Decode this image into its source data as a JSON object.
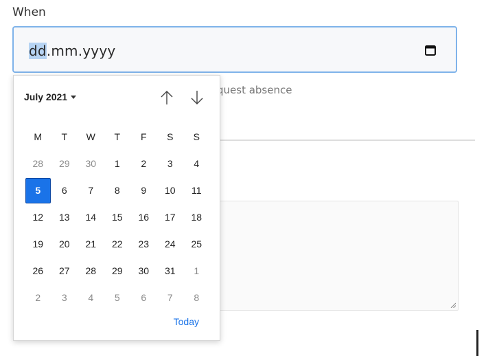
{
  "field": {
    "label": "When",
    "date_placeholder_day": "dd",
    "date_placeholder_rest": ".mm.yyyy",
    "helper_text": "quest absence"
  },
  "calendar": {
    "month_label": "July 2021",
    "weekdays": [
      "M",
      "T",
      "W",
      "T",
      "F",
      "S",
      "S"
    ],
    "weeks": [
      [
        {
          "d": "28",
          "o": true
        },
        {
          "d": "29",
          "o": true
        },
        {
          "d": "30",
          "o": true
        },
        {
          "d": "1"
        },
        {
          "d": "2"
        },
        {
          "d": "3"
        },
        {
          "d": "4"
        }
      ],
      [
        {
          "d": "5",
          "sel": true
        },
        {
          "d": "6"
        },
        {
          "d": "7"
        },
        {
          "d": "8"
        },
        {
          "d": "9"
        },
        {
          "d": "10"
        },
        {
          "d": "11"
        }
      ],
      [
        {
          "d": "12"
        },
        {
          "d": "13"
        },
        {
          "d": "14"
        },
        {
          "d": "15"
        },
        {
          "d": "16"
        },
        {
          "d": "17"
        },
        {
          "d": "18"
        }
      ],
      [
        {
          "d": "19"
        },
        {
          "d": "20"
        },
        {
          "d": "21"
        },
        {
          "d": "22"
        },
        {
          "d": "23"
        },
        {
          "d": "24"
        },
        {
          "d": "25"
        }
      ],
      [
        {
          "d": "26"
        },
        {
          "d": "27"
        },
        {
          "d": "28"
        },
        {
          "d": "29"
        },
        {
          "d": "30"
        },
        {
          "d": "31"
        },
        {
          "d": "1",
          "o": true
        }
      ],
      [
        {
          "d": "2",
          "o": true
        },
        {
          "d": "3",
          "o": true
        },
        {
          "d": "4",
          "o": true
        },
        {
          "d": "5",
          "o": true
        },
        {
          "d": "6",
          "o": true
        },
        {
          "d": "7",
          "o": true
        },
        {
          "d": "8",
          "o": true
        }
      ]
    ],
    "today_label": "Today",
    "icons": {
      "calendar": "calendar-icon",
      "up": "arrow-up-icon",
      "down": "arrow-down-icon",
      "month_dropdown": "caret-down-icon"
    },
    "colors": {
      "selected": "#1a73e8",
      "today_link": "#1a73e8",
      "focus_border": "#7fb3ea"
    }
  }
}
